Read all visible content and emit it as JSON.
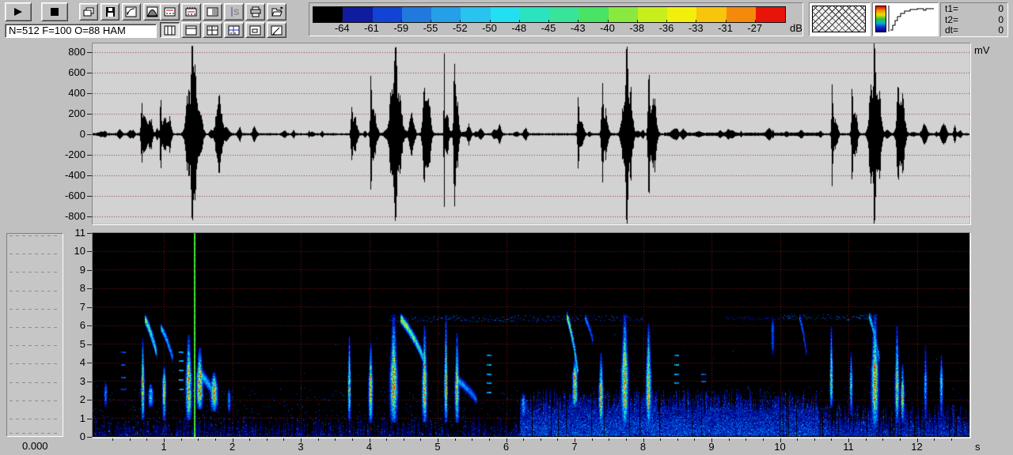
{
  "toolbar": {
    "status_text": "N=512 F=100 O=88 HAM",
    "buttons": [
      "play",
      "stop",
      "copy-window",
      "save",
      "gain-curve",
      "window-function",
      "oscillogram-view",
      "spectrogram-view",
      "palette-dither",
      "spectrum-section",
      "print",
      "open",
      "layout-split-vertical",
      "layout-top-strip",
      "layout-grid",
      "layout-cross",
      "layout-inner-box",
      "layout-edit"
    ]
  },
  "colorbar": {
    "labels": [
      "-64",
      "-61",
      "-59",
      "-55",
      "-52",
      "-50",
      "-48",
      "-45",
      "-43",
      "-40",
      "-38",
      "-36",
      "-33",
      "-31",
      "-27"
    ],
    "unit": "dB",
    "segment_colors": [
      "#000000",
      "#0f1c9f",
      "#1243d4",
      "#2079dd",
      "#25a0e8",
      "#29c3ef",
      "#22dff1",
      "#2ce3c0",
      "#37e49a",
      "#49e366",
      "#8ae93e",
      "#c8ef1c",
      "#f2ef0c",
      "#f6c50c",
      "#f58a0a",
      "#e8140a"
    ]
  },
  "cursor_readout": {
    "rows": [
      {
        "label": "t1=",
        "value": "0"
      },
      {
        "label": "t2=",
        "value": "0"
      },
      {
        "label": "dt=",
        "value": "0"
      }
    ]
  },
  "waveform": {
    "unit": "mV"
  },
  "spectrogram": {
    "unit": "s"
  },
  "time_readout": "0.000",
  "colors": {
    "window_bg": "#c0c0c0",
    "wave_bg": "#d2d2d2",
    "wave_grid_dot": "#9a3434",
    "trace": "#000000",
    "spec_bg": "#000000",
    "spec_grid_dot": "#7a1a1a",
    "cursor": "#3ce24a"
  },
  "chart_data": [
    {
      "type": "line",
      "title": "oscillogram",
      "ylabel": "mV",
      "xlim_s": [
        0,
        12.77
      ],
      "ylim_mv": [
        -870,
        885
      ],
      "y_ticks": [
        800,
        600,
        400,
        200,
        0,
        -200,
        -400,
        -600,
        -800
      ],
      "noise_floor_mv": 12,
      "bursts": [
        [
          0.67,
          240,
          0.012
        ],
        [
          0.71,
          120,
          0.045
        ],
        [
          0.8,
          130,
          0.035
        ],
        [
          0.95,
          330,
          0.012
        ],
        [
          1.01,
          170,
          0.04
        ],
        [
          1.08,
          140,
          0.03
        ],
        [
          1.36,
          380,
          0.05
        ],
        [
          1.41,
          850,
          0.016
        ],
        [
          1.45,
          480,
          0.028
        ],
        [
          1.52,
          220,
          0.045
        ],
        [
          1.8,
          330,
          0.05
        ],
        [
          2.1,
          60,
          0.025
        ],
        [
          2.32,
          70,
          0.03
        ],
        [
          3.74,
          270,
          0.014
        ],
        [
          3.78,
          120,
          0.04
        ],
        [
          4.02,
          500,
          0.012
        ],
        [
          4.06,
          230,
          0.04
        ],
        [
          4.33,
          430,
          0.045
        ],
        [
          4.38,
          820,
          0.02
        ],
        [
          4.43,
          380,
          0.05
        ],
        [
          4.62,
          170,
          0.04
        ],
        [
          4.8,
          370,
          0.03
        ],
        [
          4.86,
          290,
          0.04
        ],
        [
          5.09,
          720,
          0.008
        ],
        [
          5.13,
          200,
          0.03
        ],
        [
          5.24,
          580,
          0.016
        ],
        [
          5.28,
          300,
          0.03
        ],
        [
          5.45,
          80,
          0.03
        ],
        [
          5.62,
          40,
          0.04
        ],
        [
          5.9,
          40,
          0.03
        ],
        [
          6.28,
          50,
          0.03
        ],
        [
          7.05,
          300,
          0.012
        ],
        [
          7.09,
          140,
          0.04
        ],
        [
          7.4,
          370,
          0.018
        ],
        [
          7.45,
          200,
          0.04
        ],
        [
          7.72,
          300,
          0.045
        ],
        [
          7.76,
          760,
          0.018
        ],
        [
          7.81,
          380,
          0.04
        ],
        [
          8.08,
          480,
          0.018
        ],
        [
          8.15,
          300,
          0.045
        ],
        [
          8.45,
          40,
          0.05
        ],
        [
          10.76,
          370,
          0.012
        ],
        [
          10.8,
          150,
          0.04
        ],
        [
          11.05,
          480,
          0.012
        ],
        [
          11.09,
          200,
          0.04
        ],
        [
          11.33,
          480,
          0.04
        ],
        [
          11.38,
          820,
          0.018
        ],
        [
          11.44,
          420,
          0.04
        ],
        [
          11.72,
          480,
          0.02
        ],
        [
          11.78,
          340,
          0.045
        ],
        [
          12.1,
          70,
          0.04
        ],
        [
          12.38,
          80,
          0.04
        ],
        [
          12.55,
          60,
          0.02
        ]
      ]
    },
    {
      "type": "heatmap",
      "title": "spectrogram",
      "xlabel": "s",
      "x_ticks": [
        1,
        2,
        3,
        4,
        5,
        6,
        7,
        8,
        9,
        10,
        11,
        12
      ],
      "y_ticks": [
        0,
        1,
        2,
        3,
        4,
        5,
        6,
        7,
        8,
        9,
        10,
        11
      ],
      "xlim_s": [
        0,
        12.77
      ],
      "flim": [
        0,
        11
      ],
      "cursor_s": 1.434,
      "colormap_stops": [
        [
          0.0,
          [
            0,
            0,
            0
          ]
        ],
        [
          0.1,
          [
            0,
            0,
            140
          ]
        ],
        [
          0.25,
          [
            0,
            70,
            220
          ]
        ],
        [
          0.4,
          [
            0,
            160,
            255
          ]
        ],
        [
          0.52,
          [
            0,
            230,
            230
          ]
        ],
        [
          0.62,
          [
            70,
            230,
            110
          ]
        ],
        [
          0.72,
          [
            170,
            240,
            40
          ]
        ],
        [
          0.8,
          [
            244,
            240,
            0
          ]
        ],
        [
          0.88,
          [
            250,
            160,
            0
          ]
        ],
        [
          0.94,
          [
            244,
            80,
            0
          ]
        ],
        [
          1.0,
          [
            228,
            0,
            0
          ]
        ]
      ],
      "calls": [
        [
          0.15,
          0.02,
          1.6,
          3.0,
          2.1,
          2.6,
          0.45
        ],
        [
          0.69,
          0.02,
          0.9,
          5.3,
          2.3,
          3.1,
          0.95
        ],
        [
          0.8,
          0.03,
          1.6,
          2.9,
          1.9,
          2.5,
          0.6
        ],
        [
          1.0,
          0.022,
          0.9,
          3.8,
          2.3,
          3.0,
          0.95
        ],
        [
          1.36,
          0.035,
          0.9,
          5.5,
          2.0,
          3.3,
          1.0
        ],
        [
          1.52,
          0.038,
          1.5,
          4.8,
          2.2,
          3.3,
          1.0
        ],
        [
          1.73,
          0.042,
          1.4,
          3.5,
          2.1,
          2.8,
          0.95
        ],
        [
          1.95,
          0.02,
          1.3,
          2.6,
          1.7,
          2.3,
          0.45
        ],
        [
          3.7,
          0.018,
          0.9,
          5.4,
          2.3,
          3.1,
          0.95
        ],
        [
          4.02,
          0.025,
          0.8,
          5.1,
          2.0,
          3.0,
          0.95
        ],
        [
          4.35,
          0.045,
          0.8,
          6.6,
          2.2,
          3.4,
          1.0
        ],
        [
          4.8,
          0.03,
          0.8,
          6.0,
          2.0,
          3.2,
          1.0
        ],
        [
          5.12,
          0.02,
          0.8,
          6.5,
          2.4,
          3.3,
          1.0
        ],
        [
          5.28,
          0.026,
          0.8,
          5.6,
          2.2,
          3.0,
          0.95
        ],
        [
          6.25,
          0.03,
          1.1,
          2.4,
          1.4,
          2.0,
          0.5
        ],
        [
          7.0,
          0.03,
          1.6,
          4.2,
          2.2,
          3.4,
          0.95
        ],
        [
          7.38,
          0.028,
          0.6,
          4.5,
          1.8,
          2.6,
          0.95
        ],
        [
          7.73,
          0.042,
          0.6,
          6.6,
          2.0,
          3.6,
          1.0
        ],
        [
          8.07,
          0.032,
          0.6,
          6.1,
          2.0,
          3.3,
          0.95
        ],
        [
          9.89,
          0.02,
          4.4,
          6.5,
          5.0,
          6.0,
          0.35
        ],
        [
          10.75,
          0.018,
          1.6,
          6.0,
          2.6,
          3.7,
          0.9
        ],
        [
          11.03,
          0.018,
          1.2,
          4.6,
          2.5,
          3.2,
          0.7
        ],
        [
          11.38,
          0.042,
          0.5,
          6.6,
          2.2,
          3.6,
          1.0
        ],
        [
          11.7,
          0.025,
          0.8,
          6.0,
          2.2,
          3.2,
          0.9
        ],
        [
          11.79,
          0.022,
          0.8,
          4.0,
          1.8,
          2.6,
          0.85
        ],
        [
          12.12,
          0.02,
          1.0,
          5.0,
          2.6,
          3.1,
          0.55
        ],
        [
          12.35,
          0.02,
          1.2,
          4.4,
          2.8,
          3.1,
          0.75
        ]
      ],
      "chirps": [
        [
          0.72,
          6.35,
          0.88,
          4.6,
          0.22,
          0.8
        ],
        [
          0.95,
          5.9,
          1.12,
          4.3,
          0.18,
          0.55
        ],
        [
          4.46,
          6.35,
          4.78,
          4.3,
          0.22,
          0.85
        ],
        [
          6.88,
          6.5,
          7.04,
          3.6,
          0.2,
          0.8
        ],
        [
          1.55,
          3.3,
          1.78,
          1.9,
          0.28,
          0.5
        ],
        [
          5.3,
          3.0,
          5.56,
          2.0,
          0.22,
          0.45
        ],
        [
          7.15,
          6.4,
          7.26,
          5.2,
          0.16,
          0.4
        ],
        [
          10.28,
          6.4,
          10.38,
          4.6,
          0.16,
          0.35
        ],
        [
          11.3,
          6.5,
          11.44,
          4.2,
          0.18,
          0.6
        ]
      ],
      "dash_ladders": [
        [
          1.22,
          [
            2.6,
            3.1,
            3.6,
            4.1,
            4.6
          ],
          0.5
        ],
        [
          0.38,
          [
            2.6,
            3.2,
            3.9,
            4.6
          ],
          0.35
        ],
        [
          5.72,
          [
            2.4,
            2.9,
            3.4,
            3.9,
            4.4
          ],
          0.5
        ],
        [
          8.46,
          [
            2.9,
            3.4,
            3.9,
            4.4
          ],
          0.55
        ],
        [
          8.85,
          [
            3.0,
            3.4
          ],
          0.4
        ]
      ],
      "horizontal_bands": [
        [
          4.3,
          6.6,
          6.2,
          6.55,
          0.45
        ],
        [
          6.6,
          8.0,
          6.25,
          6.55,
          0.4
        ],
        [
          9.2,
          10.05,
          6.3,
          6.5,
          0.3
        ],
        [
          10.05,
          11.42,
          6.3,
          6.6,
          0.55
        ]
      ],
      "noise_floor": [
        [
          0,
          6.2,
          0.2,
          1.2,
          0.45
        ],
        [
          6.2,
          10.55,
          1.4,
          2.6,
          1.0
        ],
        [
          10.55,
          12.77,
          0.6,
          1.8,
          0.8
        ]
      ]
    }
  ]
}
